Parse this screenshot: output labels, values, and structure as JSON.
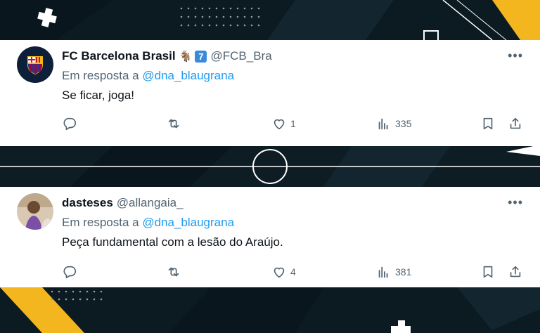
{
  "tweets": [
    {
      "display_name": "FC Barcelona Brasil",
      "emoji": "🐐",
      "badge": "7",
      "handle": "@FCB_Bra",
      "reply_prefix": "Em resposta a",
      "reply_to": "@dna_blaugrana",
      "text": "Se ficar, joga!",
      "likes": "1",
      "views": "335",
      "avatar": "barcelona-crest"
    },
    {
      "display_name": "dasteses",
      "handle": "@allangaia_",
      "reply_prefix": "Em resposta a",
      "reply_to": "@dna_blaugrana",
      "text": "Peça fundamental com a lesão do Araújo.",
      "likes": "4",
      "views": "381",
      "avatar": "user-photo"
    }
  ],
  "colors": {
    "background": "#0c1a22",
    "accent_yellow": "#f3b61f",
    "link": "#1d9bf0",
    "secondary_text": "#536471"
  }
}
